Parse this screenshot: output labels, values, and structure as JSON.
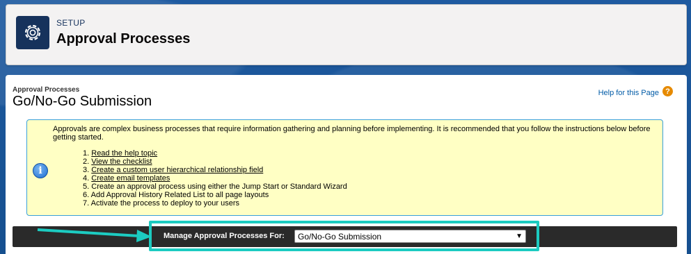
{
  "header": {
    "section": "SETUP",
    "title": "Approval Processes",
    "icon": "gear-icon"
  },
  "page": {
    "breadcrumb": "Approval Processes",
    "title": "Go/No-Go Submission",
    "help_link": "Help for this Page",
    "help_icon": "?"
  },
  "info": {
    "icon": "info-icon",
    "glyph": "i",
    "intro": "Approvals are complex business processes that require information gathering and planning before implementing. It is recommended that you follow the instructions below before getting started.",
    "steps": [
      {
        "num": "1.",
        "text": "Read the help topic",
        "link": true
      },
      {
        "num": "2.",
        "text": "View the checklist",
        "link": true
      },
      {
        "num": "3.",
        "text": "Create a custom user hierarchical relationship field",
        "link": true
      },
      {
        "num": "4.",
        "text": "Create email templates",
        "link": true
      },
      {
        "num": "5.",
        "text": "Create an approval process using either the Jump Start or Standard Wizard",
        "link": false
      },
      {
        "num": "6.",
        "text": "Add Approval History Related List to all page layouts",
        "link": false
      },
      {
        "num": "7.",
        "text": "Activate the process to deploy to your users",
        "link": false
      }
    ]
  },
  "manage": {
    "label": "Manage Approval Processes For:",
    "selected": "Go/No-Go Submission"
  },
  "colors": {
    "highlight": "#1ccbc1",
    "bar": "#2a2a2a",
    "info_bg": "#ffffc4"
  }
}
